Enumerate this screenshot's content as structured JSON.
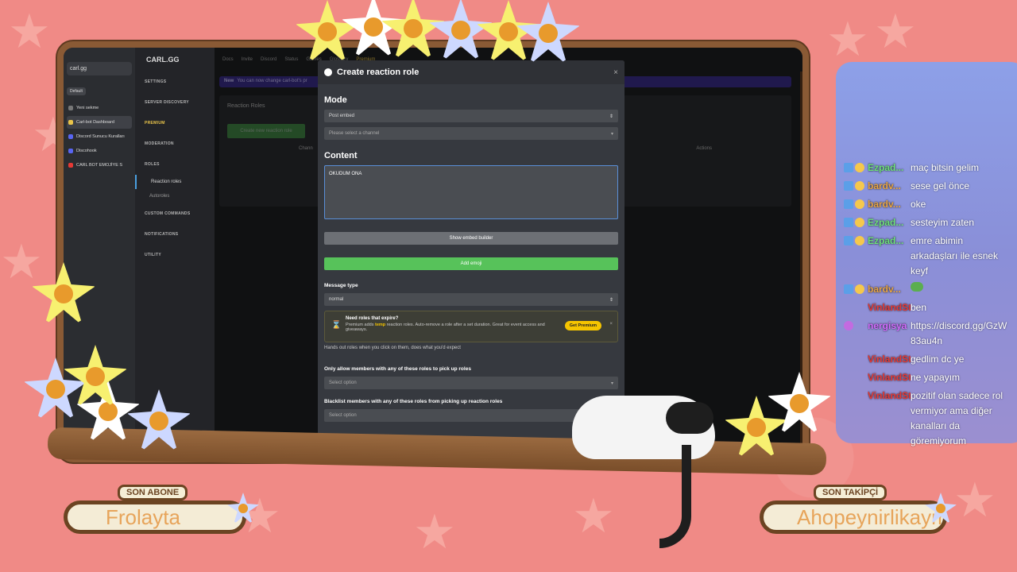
{
  "browser_tabs": {
    "search_value": "carl.gg",
    "default_label": "Default",
    "items": [
      {
        "label": "Yeni sekme"
      },
      {
        "label": "Carl-bot Dashboard"
      },
      {
        "label": "Discord Sunucu Kuralları"
      },
      {
        "label": "Discohook"
      },
      {
        "label": "CARL BOT EMOJİYE S"
      }
    ]
  },
  "dashboard": {
    "logo": "CARL.GG",
    "topbar": [
      "Docs",
      "Invite",
      "Discord",
      "Status",
      "Games",
      "Glossary",
      "Premium"
    ],
    "banner_tag": "New",
    "banner_text": "You can now change carl-bot's pr",
    "nav": [
      {
        "label": "SETTINGS"
      },
      {
        "label": "SERVER DISCOVERY"
      },
      {
        "label": "PREMIUM"
      },
      {
        "label": "MODERATION"
      },
      {
        "label": "ROLES"
      },
      {
        "label": "Reaction roles"
      },
      {
        "label": "Autoroles"
      },
      {
        "label": "CUSTOM COMMANDS"
      },
      {
        "label": "NOTIFICATIONS"
      },
      {
        "label": "UTILITY"
      }
    ],
    "section_title": "Reaction Roles",
    "create_button": "Create new reaction role",
    "table_headers": [
      "Chann",
      "Actions"
    ]
  },
  "modal": {
    "title": "Create reaction role",
    "close": "×",
    "mode_heading": "Mode",
    "mode_value": "Post embed",
    "channel_placeholder": "Please select a channel",
    "content_heading": "Content",
    "content_value": "OKUDUM ONA",
    "embed_button": "Show embed builder",
    "add_emoji_button": "Add emoji",
    "message_type_label": "Message type",
    "message_type_value": "normal",
    "premium": {
      "title": "Need roles that expire?",
      "text_before": "Premium adds ",
      "text_highlight": "temp",
      "text_after": " reaction roles. Auto-remove a role after a set duration. Great for event access and giveaways.",
      "button": "Get Premium",
      "close": "×"
    },
    "help_text": "Hands out roles when you click on them, does what you'd expect",
    "allow_label": "Only allow members with any of these roles to pick up roles",
    "allow_placeholder": "Select option",
    "blacklist_label": "Blacklist members with any of these roles from picking up reaction roles",
    "blacklist_placeholder": "Select option"
  },
  "chat": [
    {
      "user": "Ezpad...",
      "color": "green",
      "badges": [
        "box",
        "gear"
      ],
      "text": "maç bitsin gelim"
    },
    {
      "user": "bardv...",
      "color": "orange",
      "badges": [
        "box",
        "gear"
      ],
      "text": "sese gel önce"
    },
    {
      "user": "bardv...",
      "color": "orange",
      "badges": [
        "box",
        "gear"
      ],
      "text": "oke"
    },
    {
      "user": "Ezpad...",
      "color": "green",
      "badges": [
        "box",
        "gear"
      ],
      "text": "sesteyim zaten"
    },
    {
      "user": "Ezpad...",
      "color": "green",
      "badges": [
        "box",
        "gear"
      ],
      "text": "emre abimin arkadaşları ile esnek keyf"
    },
    {
      "user": "bardv...",
      "color": "orange",
      "badges": [
        "box",
        "gear"
      ],
      "text": ""
    },
    {
      "user": "VinlandSto...",
      "color": "red",
      "badges": [],
      "text": "ben"
    },
    {
      "user": "nergisya",
      "color": "purple",
      "badges": [
        "mic"
      ],
      "text": "https://discord.gg/GzW83au4n"
    },
    {
      "user": "VinlandSto...",
      "color": "red",
      "badges": [],
      "text": "gedlim dc ye"
    },
    {
      "user": "VinlandSto...",
      "color": "red",
      "badges": [],
      "text": "ne yapayım"
    },
    {
      "user": "VinlandSto...",
      "color": "red",
      "badges": [],
      "text": "pozitif olan sadece rol vermiyor ama diğer kanalları da göremiyorum"
    }
  ],
  "overlay": {
    "last_sub_tag": "SON ABONE",
    "last_sub_name": "Frolayta",
    "last_follow_tag": "SON TAKİPÇİ",
    "last_follow_name": "Ahopeynirlikaymak"
  }
}
